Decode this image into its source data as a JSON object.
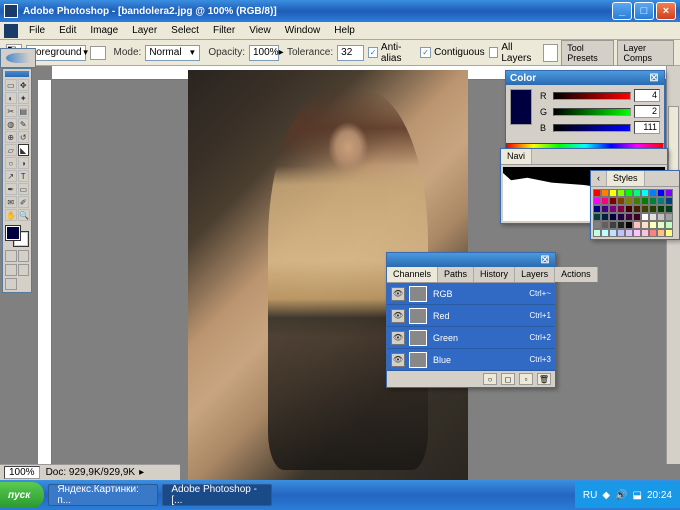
{
  "window": {
    "title": "Adobe Photoshop - [bandolera2.jpg @ 100% (RGB/8)]"
  },
  "menu": {
    "items": [
      "File",
      "Edit",
      "Image",
      "Layer",
      "Select",
      "Filter",
      "View",
      "Window",
      "Help"
    ]
  },
  "options": {
    "fill_label": "Foreground",
    "pattern_label": "",
    "mode_label": "Mode:",
    "mode_value": "Normal",
    "opacity_label": "Opacity:",
    "opacity_value": "100%",
    "tolerance_label": "Tolerance:",
    "tolerance_value": "32",
    "antialias": "Anti-alias",
    "contiguous": "Contiguous",
    "all_layers": "All Layers",
    "right_a": "Tool Presets",
    "right_b": "Layer Comps"
  },
  "status": {
    "zoom": "100%",
    "doc": "Doc: 929,9K/929,9K"
  },
  "color_panel": {
    "title": "Color",
    "r_label": "R",
    "r_val": "4",
    "g_label": "G",
    "g_val": "2",
    "b_label": "B",
    "b_val": "111"
  },
  "nav_panel": {
    "tab": "Navi"
  },
  "swatches_panel": {
    "tab": "Styles"
  },
  "channels_panel": {
    "tabs": [
      "Channels",
      "Paths",
      "History",
      "Layers",
      "Actions"
    ],
    "rows": [
      {
        "name": "RGB",
        "key": "Ctrl+~"
      },
      {
        "name": "Red",
        "key": "Ctrl+1"
      },
      {
        "name": "Green",
        "key": "Ctrl+2"
      },
      {
        "name": "Blue",
        "key": "Ctrl+3"
      }
    ]
  },
  "taskbar": {
    "start": "пуск",
    "tasks": [
      "Яндекс.Картинки: п...",
      "Adobe Photoshop - [..."
    ],
    "lang": "RU",
    "clock": "20:24"
  },
  "swatch_colors": [
    "#ff0000",
    "#ff8000",
    "#ffff00",
    "#80ff00",
    "#00ff00",
    "#00ff80",
    "#00ffff",
    "#0080ff",
    "#0000ff",
    "#8000ff",
    "#ff00ff",
    "#ff0080",
    "#800000",
    "#804000",
    "#808000",
    "#408000",
    "#008000",
    "#008040",
    "#008080",
    "#004080",
    "#000080",
    "#400080",
    "#800080",
    "#800040",
    "#400000",
    "#402000",
    "#404000",
    "#204000",
    "#004000",
    "#004020",
    "#004040",
    "#002040",
    "#000040",
    "#200040",
    "#400040",
    "#400020",
    "#ffffff",
    "#e0e0e0",
    "#c0c0c0",
    "#a0a0a0",
    "#808080",
    "#606060",
    "#404040",
    "#202020",
    "#000000",
    "#ffc0c0",
    "#ffe0c0",
    "#ffffc0",
    "#e0ffc0",
    "#c0ffc0",
    "#c0ffe0",
    "#c0ffff",
    "#c0e0ff",
    "#c0c0ff",
    "#e0c0ff",
    "#ffc0ff",
    "#ffc0e0",
    "#ff8080",
    "#ffc080",
    "#ffff80"
  ]
}
